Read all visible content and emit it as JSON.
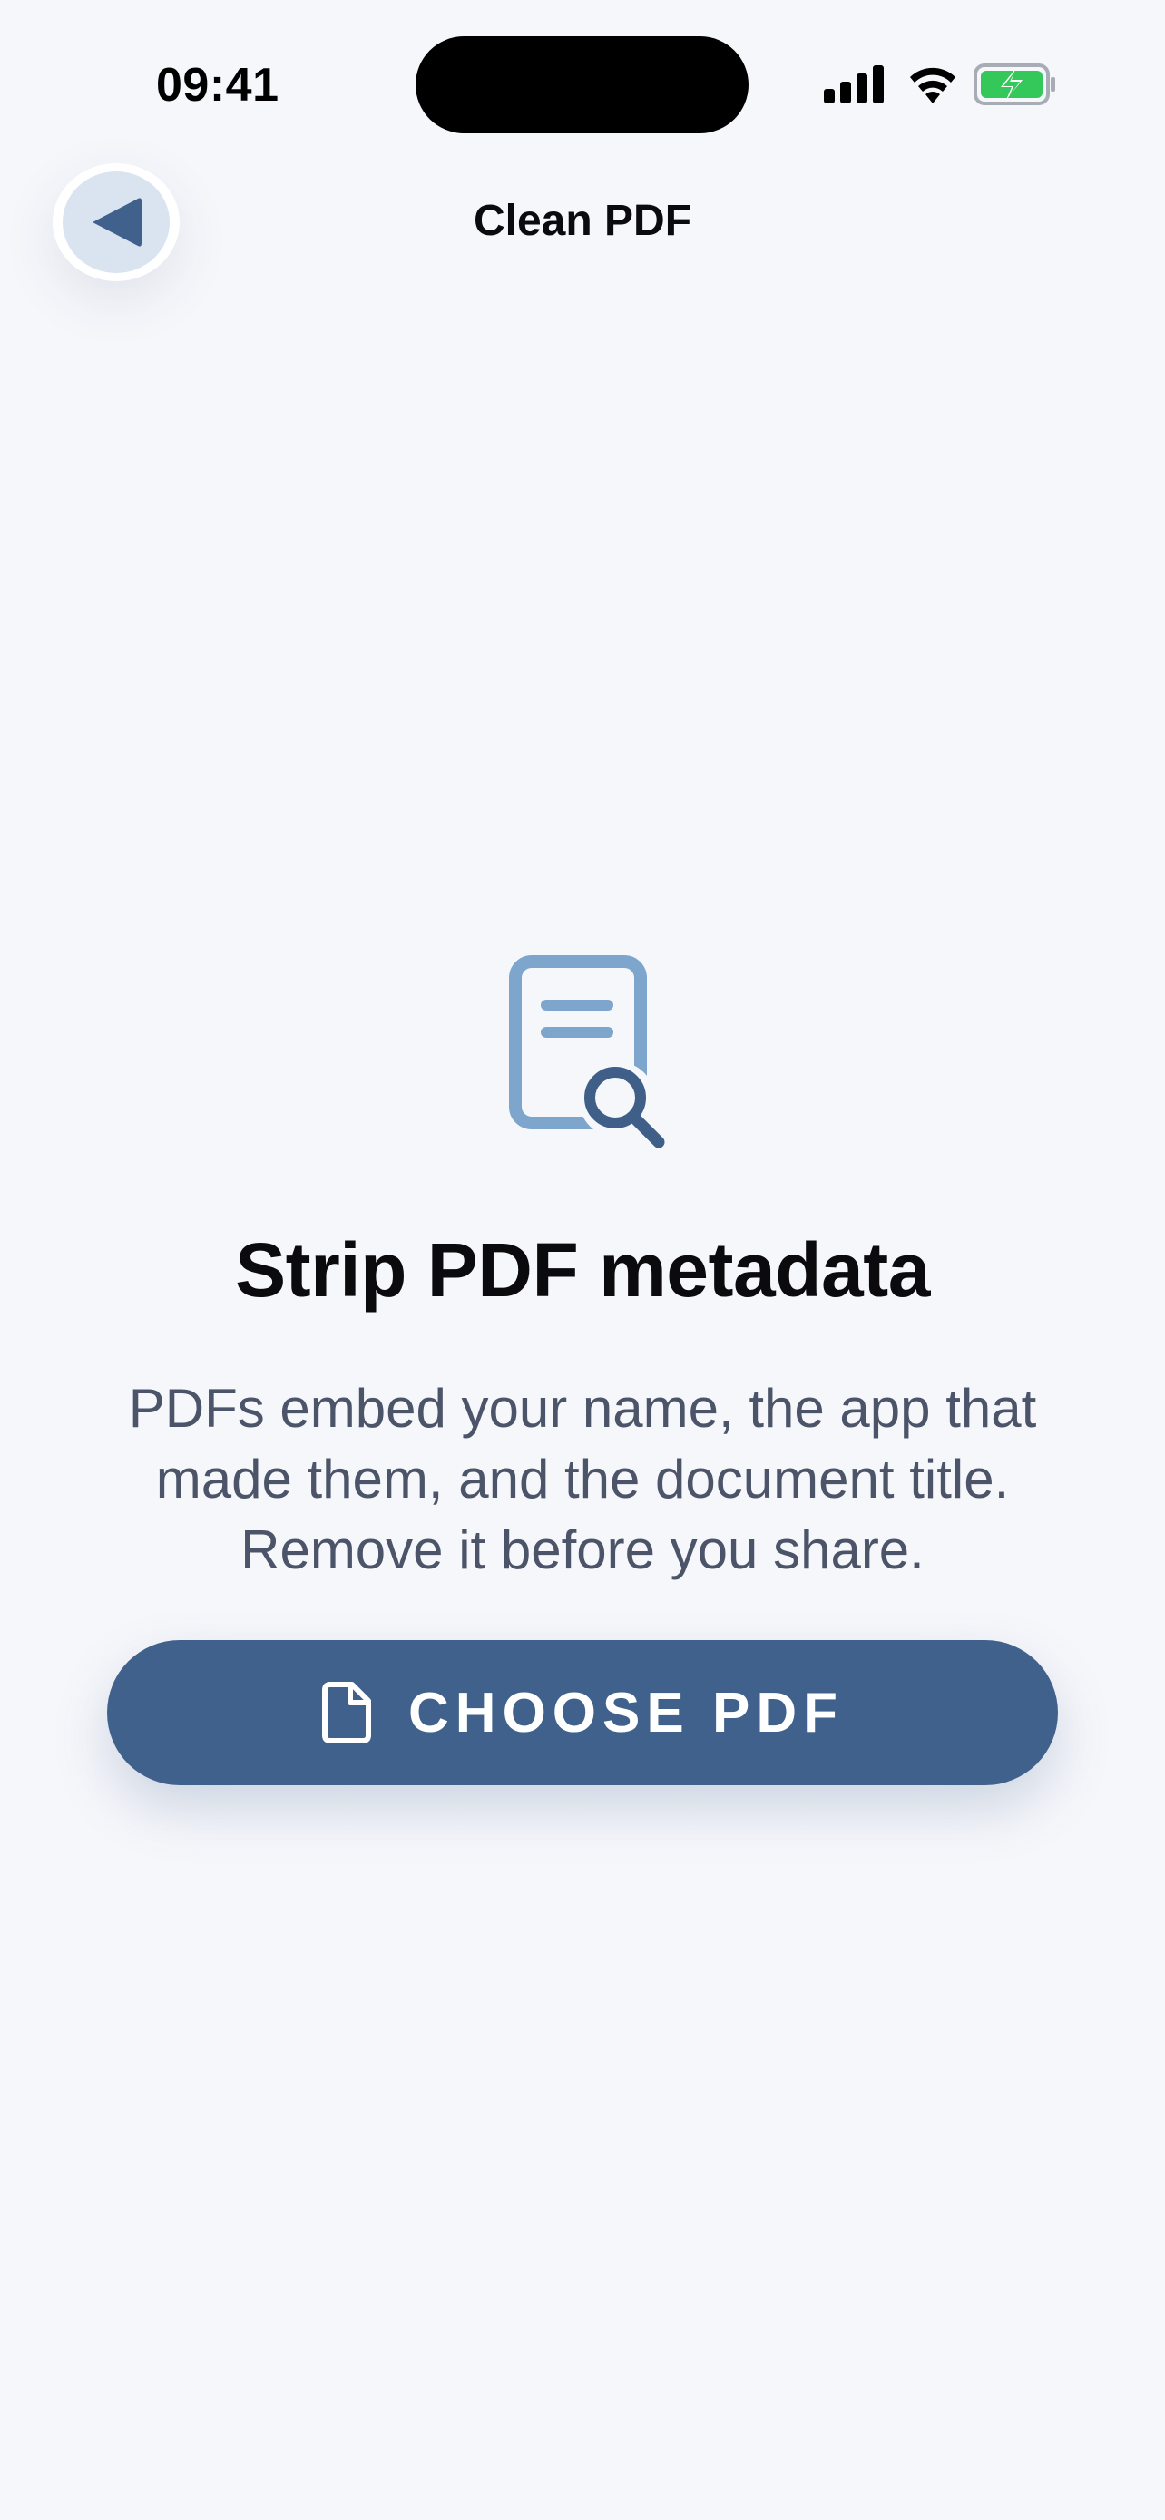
{
  "status_bar": {
    "time": "09:41",
    "icons": [
      "signal-icon",
      "wifi-icon",
      "battery-charging-icon"
    ]
  },
  "nav": {
    "title": "Clean PDF",
    "back_icon": "back-arrow-icon"
  },
  "main": {
    "hero_icon": "document-search-icon",
    "headline": "Strip PDF metadata",
    "description": "PDFs embed your name, the app that made them, and the document title. Remove it before you share.",
    "button": {
      "label": "CHOOSE PDF",
      "icon": "file-icon"
    }
  },
  "colors": {
    "background": "#f6f7fb",
    "accent": "#40618b",
    "accent_light": "#dae3f0",
    "icon_light": "#7ea5cc",
    "text_primary": "#0b0b0d",
    "text_secondary": "#4b5468",
    "battery_green": "#34c759"
  }
}
